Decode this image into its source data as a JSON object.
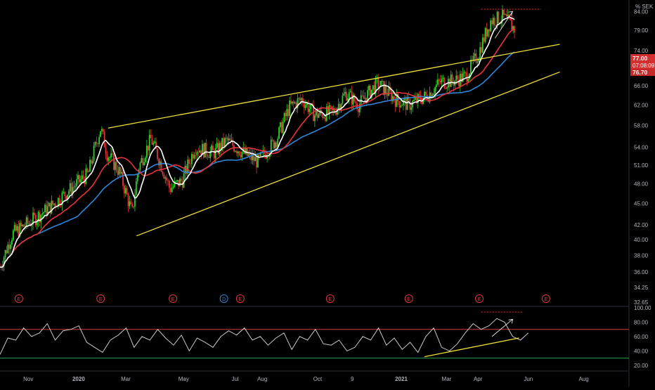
{
  "currency_label": "% SEK",
  "price_badges": {
    "last": "77.00",
    "countdown": "07:08:09",
    "ma": "76.70"
  },
  "colors": {
    "background": "#000000",
    "up_candle": "#26a69a",
    "up_candle_bright": "#2bd12b",
    "down_candle": "#e0343a",
    "ma_short": "#ffffff",
    "ma_mid": "#e8333a",
    "ma_long": "#2f86d8",
    "trendline": "#f0e03a",
    "rsi_line": "#c9c9c9",
    "rsi_upper": "#d83a3a",
    "rsi_lower": "#2e9e47",
    "badge_red": "#d32f2f",
    "earnings_marker": "#d83a3a",
    "dividend_marker": "#2f86d8",
    "text": "#b2b5be"
  },
  "chart_data": [
    {
      "type": "candlestick",
      "y_axis_ticks": [
        "84.00",
        "79.00",
        "74.00",
        "70.00",
        "66.00",
        "62.00",
        "58.00",
        "54.00",
        "51.00",
        "48.00",
        "45.00",
        "42.00",
        "40.00",
        "38.00",
        "36.00",
        "34.25",
        "32.65"
      ],
      "ylim": [
        32.65,
        86
      ],
      "y_scale": "log",
      "x_axis_labels": [
        "Nov",
        "2020",
        "Mar",
        "May",
        "Jul",
        "Aug",
        "Oct",
        "9",
        "2021",
        "Mar",
        "Apr",
        "Jun",
        "Aug"
      ],
      "close_series": {
        "time": [
          0,
          0.02,
          0.05,
          0.08,
          0.11,
          0.14,
          0.16,
          0.17,
          0.19,
          0.21,
          0.22,
          0.24,
          0.27,
          0.29,
          0.31,
          0.34,
          0.36,
          0.39,
          0.41,
          0.44,
          0.46,
          0.48,
          0.5,
          0.53,
          0.55,
          0.57,
          0.6,
          0.63,
          0.65,
          0.68,
          0.7,
          0.72,
          0.74,
          0.76,
          0.78,
          0.8,
          0.82,
          0.84,
          0.85,
          0.86,
          0.87,
          0.88,
          0.9
        ],
        "values": [
          36.6,
          40.8,
          42.5,
          44.5,
          47.0,
          49.5,
          57.5,
          53.0,
          49.8,
          43.5,
          50.5,
          55.5,
          47.2,
          48.5,
          54.0,
          53.0,
          55.2,
          52.8,
          51.5,
          55.5,
          61.5,
          63.2,
          60.0,
          60.5,
          64.5,
          62.0,
          66.5,
          63.0,
          62.0,
          64.0,
          66.8,
          67.0,
          68.0,
          73.0,
          81.5,
          82.5,
          79.0,
          77.0,
          77.0,
          77.0,
          77.0,
          77.0,
          77.0
        ]
      },
      "earnings_markers": [
        "E",
        "E",
        "E",
        "E",
        "E",
        "E",
        "E",
        "E"
      ],
      "dividend_marker": "D",
      "target_line_value": 84.6
    },
    {
      "type": "line",
      "name": "RSI",
      "y_axis_ticks": [
        "100.00",
        "80.00",
        "60.00",
        "40.00",
        "20.00"
      ],
      "ylim": [
        14,
        100
      ],
      "upper_band": 70,
      "lower_band": 30,
      "values": [
        35,
        58,
        55,
        72,
        60,
        65,
        78,
        55,
        68,
        70,
        75,
        52,
        45,
        38,
        55,
        62,
        72,
        45,
        60,
        55,
        70,
        58,
        48,
        62,
        40,
        58,
        52,
        45,
        60,
        68,
        62,
        72,
        55,
        60,
        48,
        58,
        65,
        42,
        60,
        55,
        70,
        50,
        48,
        55,
        40,
        45,
        60,
        55,
        72,
        48,
        58,
        42,
        52,
        38,
        60,
        72,
        45,
        40,
        50,
        65,
        78,
        70,
        75,
        85,
        80,
        60,
        55,
        65
      ]
    }
  ]
}
